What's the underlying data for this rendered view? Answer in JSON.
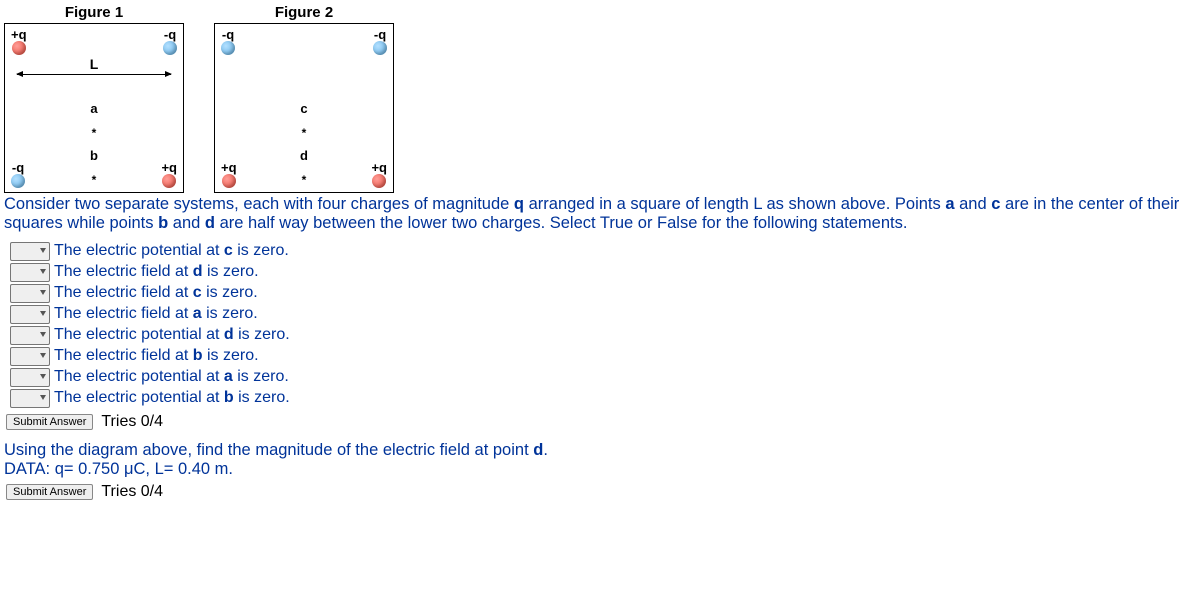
{
  "figures": {
    "fig1": {
      "title": "Figure 1",
      "L_label": "L",
      "point_a": "a",
      "point_b": "b",
      "chargeLabels": {
        "tl": "+q",
        "tr": "-q",
        "bl": "-q",
        "br": "+q"
      }
    },
    "fig2": {
      "title": "Figure 2",
      "point_c": "c",
      "point_d": "d",
      "chargeLabels": {
        "tl": "-q",
        "tr": "-q",
        "bl": "+q",
        "br": "+q"
      }
    }
  },
  "intro": {
    "seg1": "Consider two separate systems, each with four charges of magnitude ",
    "q": "q",
    "seg2": " arranged in a square of length L as shown above. Points ",
    "a": "a",
    "seg3": " and ",
    "c": "c",
    "seg4": " are in the center of their squares while points ",
    "b": "b",
    "seg5": " and ",
    "d": "d",
    "seg6": " are half way between the lower two charges. Select True or False for the following statements."
  },
  "statements": [
    {
      "t1": "The electric potential at ",
      "b": "c",
      "t2": " is zero."
    },
    {
      "t1": "The electric field at ",
      "b": "d",
      "t2": " is zero."
    },
    {
      "t1": "The electric field at ",
      "b": "c",
      "t2": " is zero."
    },
    {
      "t1": "The electric field at ",
      "b": "a",
      "t2": " is zero."
    },
    {
      "t1": "The electric potential at ",
      "b": "d",
      "t2": " is zero."
    },
    {
      "t1": "The electric field at ",
      "b": "b",
      "t2": " is zero."
    },
    {
      "t1": "The electric potential at ",
      "b": "a",
      "t2": " is zero."
    },
    {
      "t1": "The electric potential at ",
      "b": "b",
      "t2": " is zero."
    }
  ],
  "controls": {
    "submit": "Submit Answer",
    "tries1": "Tries 0/4",
    "tries2": "Tries 0/4"
  },
  "part2": {
    "line1a": "Using the diagram above, find the magnitude of the electric field at point ",
    "line1b": "d",
    "line1c": ".",
    "line2": "DATA: q= 0.750 μC, L= 0.40 m."
  }
}
